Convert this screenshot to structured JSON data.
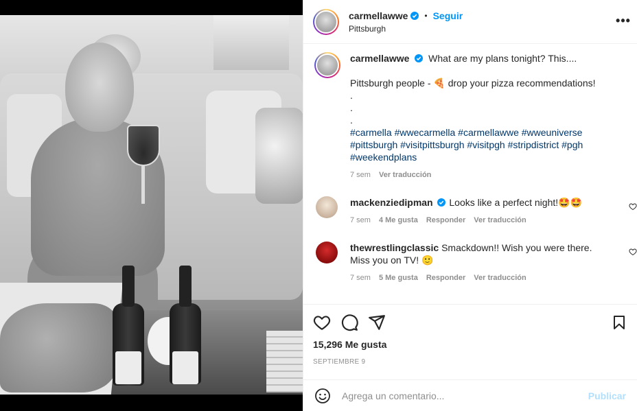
{
  "colors": {
    "accent": "#0095f6",
    "text": "#262626",
    "muted": "#8e8e8e",
    "hashtag": "#00376b",
    "post_disabled": "#b2dffc"
  },
  "post": {
    "author": {
      "username": "carmellawwe",
      "verified": true,
      "location": "Pittsburgh"
    },
    "follow_label": "Seguir",
    "separator": "•",
    "more_label": "•••",
    "caption": {
      "line1": "What are my plans tonight? This....",
      "line2": "Pittsburgh people - 🍕 drop your pizza recommendations!",
      "dot1": ".",
      "dot2": ".",
      "dot3": ".",
      "tags1": "#carmella #wwecarmella #carmellawwe #wweuniverse",
      "tags2": "#pittsburgh #visitpittsburgh #visitpgh #stripdistrict #pgh",
      "tags3": "#weekendplans",
      "time": "7 sem",
      "translate": "Ver traducción"
    },
    "comments": [
      {
        "username": "mackenziedipman",
        "verified": true,
        "text": "Looks like a perfect night!🤩🤩",
        "time": "7 sem",
        "likes": "4 Me gusta",
        "reply": "Responder",
        "translate": "Ver traducción"
      },
      {
        "username": "thewrestlingclassic",
        "verified": false,
        "text": "Smackdown!! Wish you were there. Miss you on TV! 🙂",
        "time": "7 sem",
        "likes": "5 Me gusta",
        "reply": "Responder",
        "translate": "Ver traducción"
      }
    ],
    "likes_label": "15,296 Me gusta",
    "date": "SEPTIEMBRE 9"
  },
  "add_comment": {
    "placeholder": "Agrega un comentario...",
    "post_label": "Publicar"
  },
  "icons": [
    "verified-icon",
    "more-icon",
    "heart-icon",
    "comment-icon",
    "share-icon",
    "bookmark-icon",
    "emoji-icon",
    "small-heart-icon"
  ]
}
